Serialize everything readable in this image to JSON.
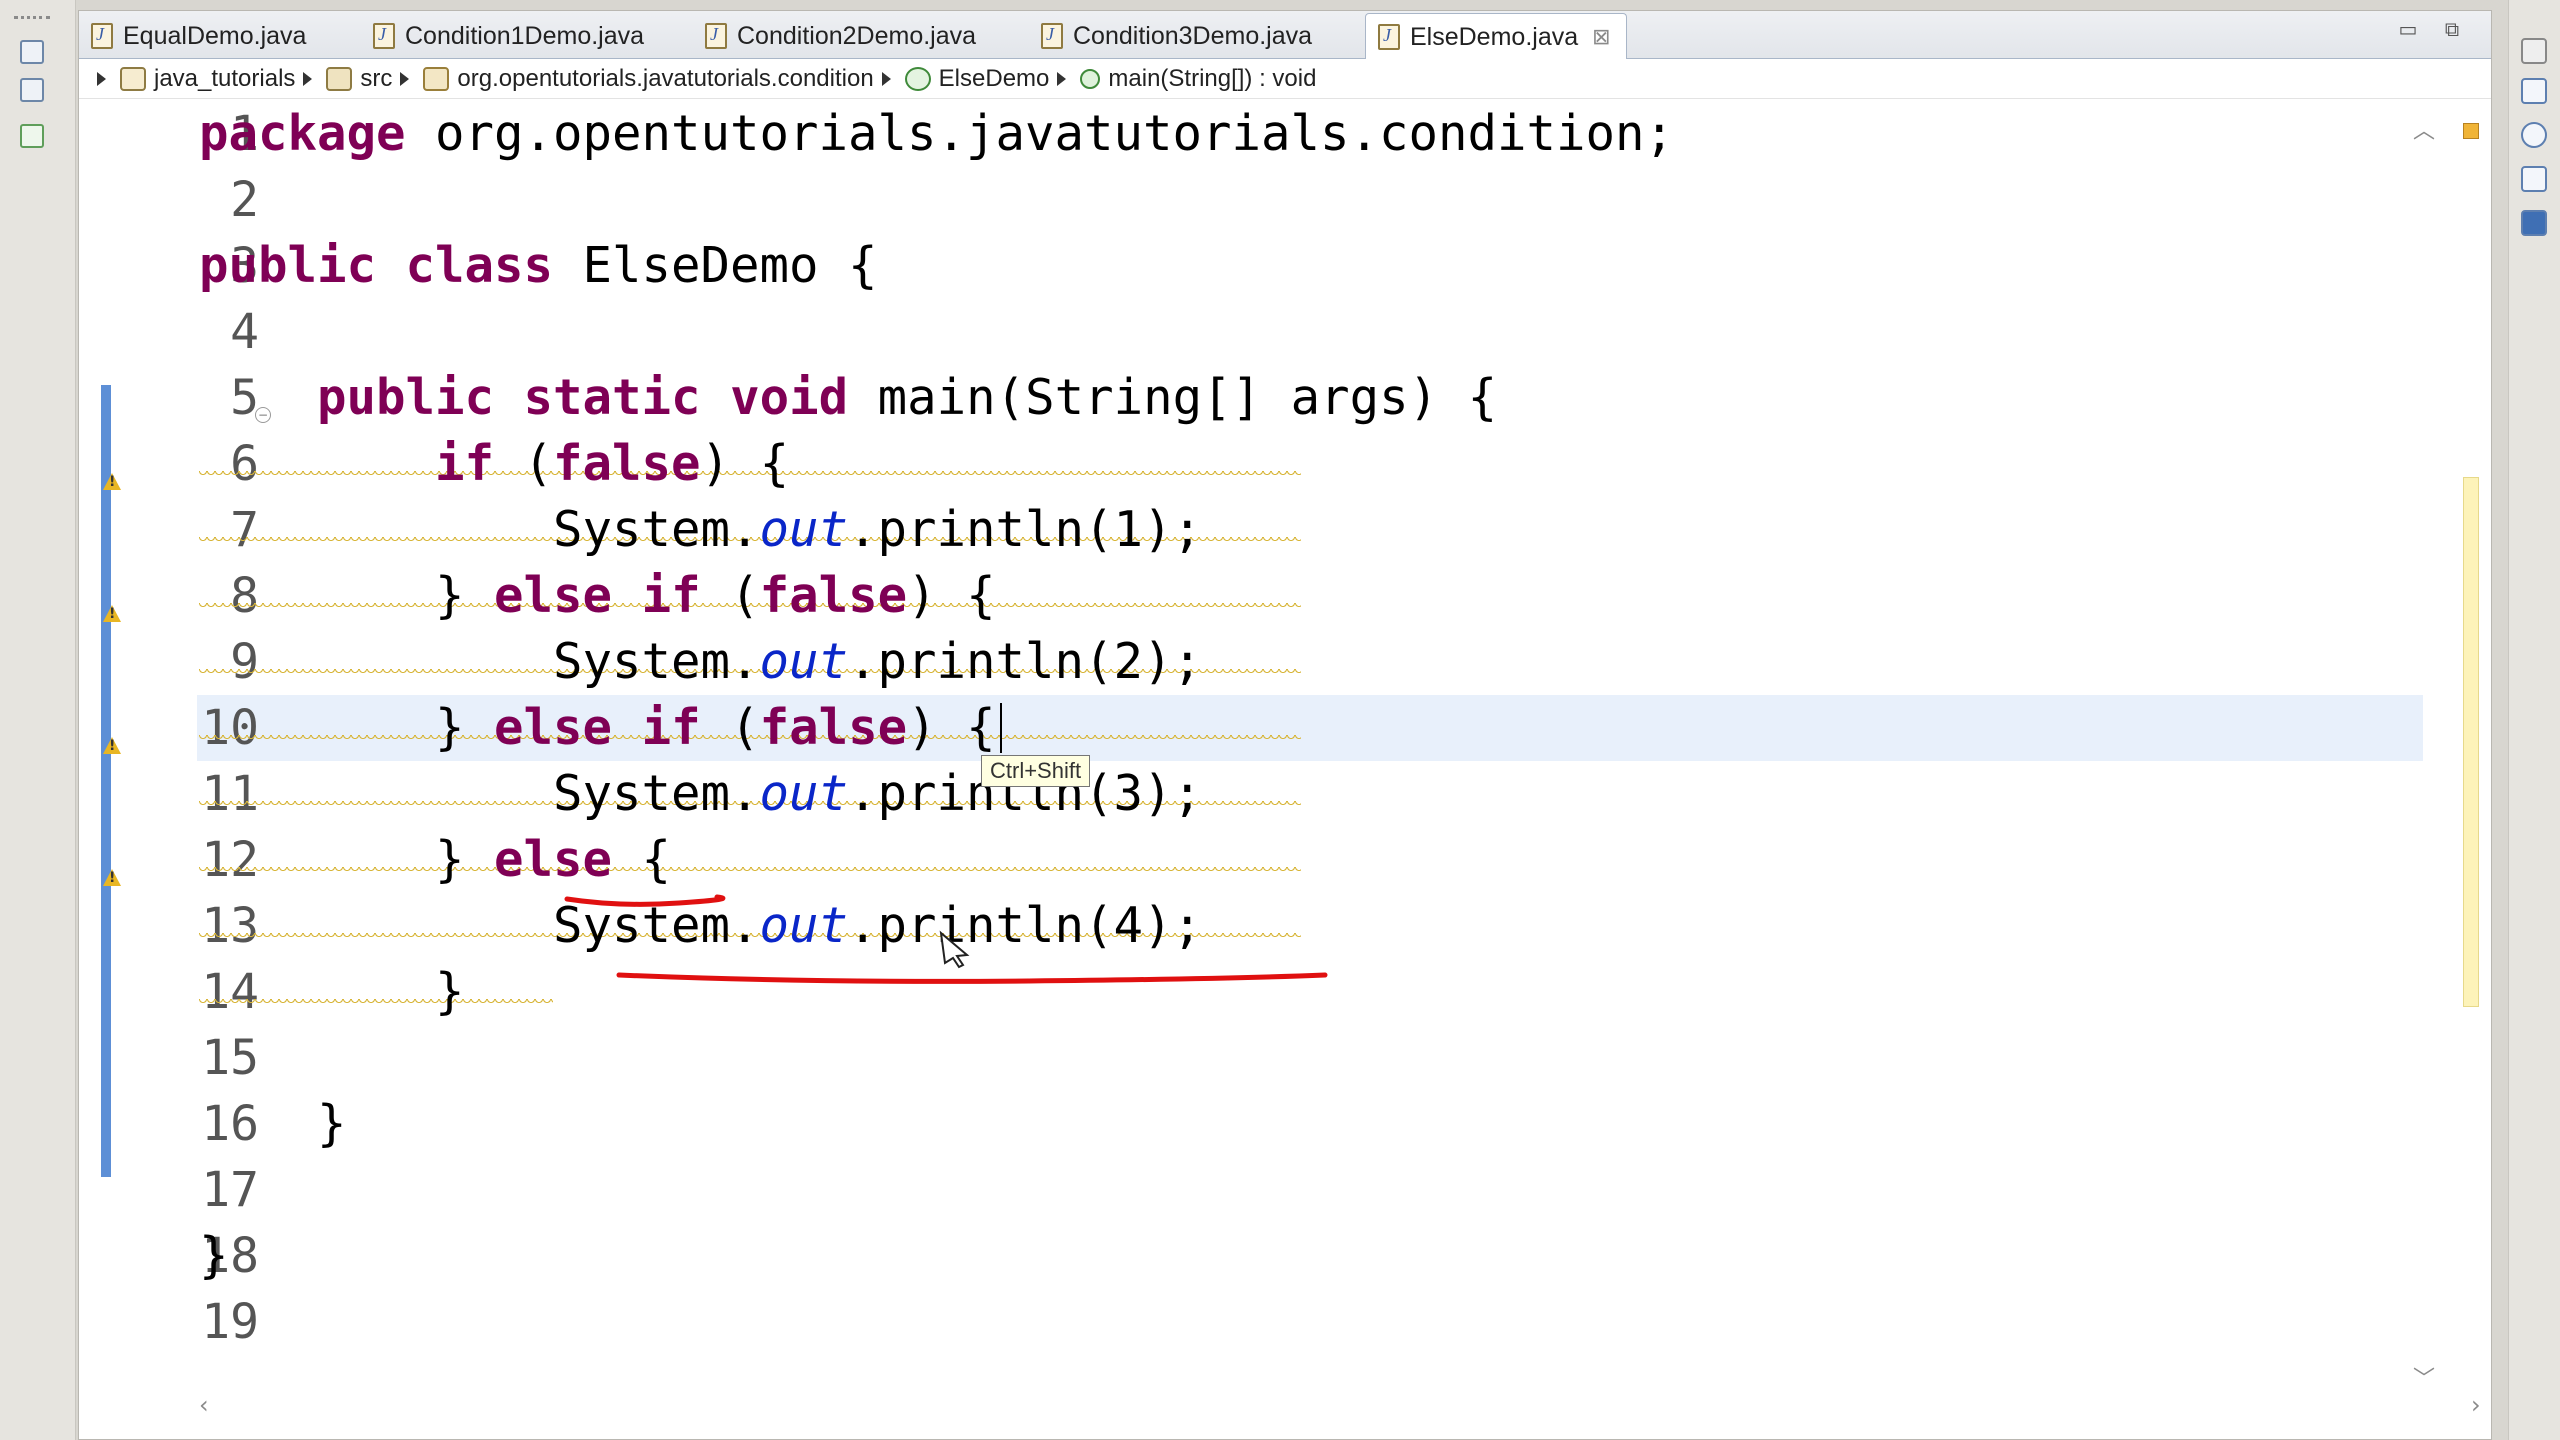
{
  "tabs": [
    {
      "label": "EqualDemo.java",
      "active": false
    },
    {
      "label": "Condition1Demo.java",
      "active": false
    },
    {
      "label": "Condition2Demo.java",
      "active": false
    },
    {
      "label": "Condition3Demo.java",
      "active": false
    },
    {
      "label": "ElseDemo.java",
      "active": true
    }
  ],
  "breadcrumb": {
    "project": "java_tutorials",
    "source_folder": "src",
    "package": "org.opentutorials.javatutorials.condition",
    "class": "ElseDemo",
    "method": "main(String[]) : void"
  },
  "tooltip": "Ctrl+Shift",
  "line_numbers": [
    "1",
    "2",
    "3",
    "4",
    "5",
    "6",
    "7",
    "8",
    "9",
    "10",
    "11",
    "12",
    "13",
    "14",
    "15",
    "16",
    "17",
    "18",
    "19"
  ],
  "code": {
    "l1": {
      "kw": "package",
      "rest": " org.opentutorials.javatutorials.condition;"
    },
    "l3": {
      "kw1": "public",
      "kw2": "class",
      "rest": " ElseDemo {"
    },
    "l5": {
      "indent": "    ",
      "kw1": "public",
      "kw2": "static",
      "kw3": "void",
      "rest": " main(String[] args) {"
    },
    "l6": {
      "indent": "        ",
      "kw1": "if",
      "p1": " (",
      "kw2": "false",
      "p2": ") {"
    },
    "l7": {
      "indent": "            ",
      "a": "System.",
      "field": "out",
      "b": ".println(1);"
    },
    "l8": {
      "indent": "        ",
      "p0": "} ",
      "kw1": "else",
      "sp": " ",
      "kw2": "if",
      "p1": " (",
      "kw3": "false",
      "p2": ") {"
    },
    "l9": {
      "indent": "            ",
      "a": "System.",
      "field": "out",
      "b": ".println(2);"
    },
    "l10": {
      "indent": "        ",
      "p0": "} ",
      "kw1": "else",
      "sp": " ",
      "kw2": "if",
      "p1": " (",
      "kw3": "false",
      "p2": ") {"
    },
    "l11": {
      "indent": "            ",
      "a": "System.",
      "field": "out",
      "b": ".println(3);"
    },
    "l12": {
      "indent": "        ",
      "p0": "} ",
      "kw1": "else",
      "p1": " {"
    },
    "l13": {
      "indent": "            ",
      "a": "System.",
      "field": "out",
      "b": ".println(4);"
    },
    "l14": {
      "indent": "        ",
      "p0": "}"
    },
    "l16": {
      "indent": "    ",
      "p0": "}"
    },
    "l18": {
      "p0": "}"
    }
  },
  "colors": {
    "keyword": "#7f0055",
    "static_field": "#0a26c8",
    "current_line": "#e8f0fb",
    "change_bar": "#5d8fd6",
    "warning": "#e8b624",
    "annotation_pen": "#e01010"
  },
  "icons": {
    "tab_file": "java-file-icon",
    "tab_close": "close-icon",
    "breadcrumb_project": "java-project-icon",
    "breadcrumb_src": "source-folder-icon",
    "breadcrumb_package": "package-icon",
    "breadcrumb_class": "class-icon",
    "breadcrumb_method": "method-icon",
    "gutter_warning": "warning-icon"
  }
}
